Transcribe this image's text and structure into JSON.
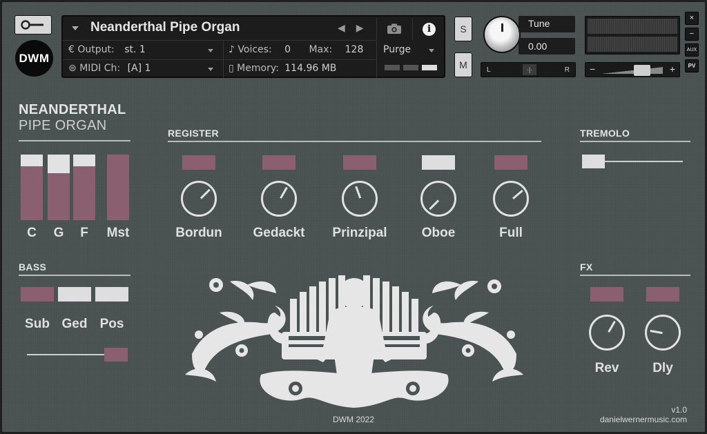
{
  "header": {
    "instrument_name": "Neanderthal Pipe Organ",
    "output_label": "Output:",
    "output_value": "st. 1",
    "midi_label": "MIDI Ch:",
    "midi_value": "[A]  1",
    "voices_label": "Voices:",
    "voices_value": "0",
    "max_label": "Max:",
    "max_value": "128",
    "memory_label": "Memory:",
    "memory_value": "114.96 MB",
    "purge_label": "Purge",
    "solo_label": "S",
    "mute_label": "M",
    "tune_label": "Tune",
    "tune_value": "0.00",
    "pan_left": "L",
    "pan_right": "R",
    "pan_center": "·|·",
    "vol_minus": "−",
    "vol_plus": "+",
    "close_label": "×",
    "min_label": "−",
    "aux_label": "AUX",
    "pv_label": "PV",
    "logo_text": "DWM"
  },
  "brand": {
    "line1": "NEANDERTHAL",
    "line2": "PIPE ORGAN"
  },
  "levels": {
    "items": [
      {
        "label": "C",
        "value": 0.82
      },
      {
        "label": "G",
        "value": 0.72
      },
      {
        "label": "F",
        "value": 0.82
      },
      {
        "label": "Mst",
        "value": 1.0
      }
    ]
  },
  "register": {
    "title": "REGISTER",
    "stops": [
      {
        "label": "Bordun",
        "active": false
      },
      {
        "label": "Gedackt",
        "active": false
      },
      {
        "label": "Prinzipal",
        "active": false
      },
      {
        "label": "Oboe",
        "active": true
      },
      {
        "label": "Full",
        "active": false
      }
    ]
  },
  "tremolo": {
    "title": "TREMOLO",
    "value": 0.0
  },
  "bass": {
    "title": "BASS",
    "buttons": [
      {
        "label": "Sub",
        "active": false
      },
      {
        "label": "Ged",
        "active": true
      },
      {
        "label": "Pos",
        "active": true
      }
    ],
    "slider_value": 1.0
  },
  "fx": {
    "title": "FX",
    "knobs": [
      {
        "label": "Rev"
      },
      {
        "label": "Dly"
      }
    ]
  },
  "footer": {
    "copyright": "DWM 2022",
    "version": "v1.0",
    "website": "danielwernermusic.com"
  },
  "colors": {
    "accent_pink": "#8a6070",
    "active_white": "#dedede",
    "background": "#4a5252"
  }
}
